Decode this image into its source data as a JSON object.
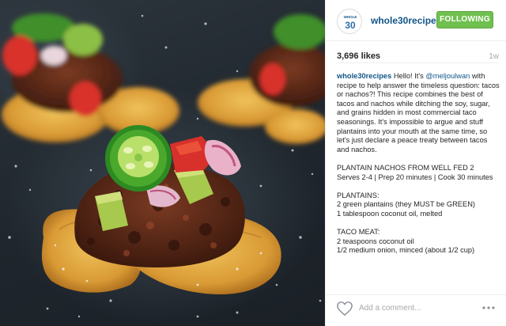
{
  "post": {
    "photo": {
      "subject": "plantain nachos with taco meat, jalapeno, avocado, tomato and onion on a dark slate board"
    },
    "header": {
      "avatar": {
        "logo_text_top": "WHOLE",
        "logo_text_number": "30"
      },
      "username": "whole30recipes",
      "follow_label": "FOLLOWING",
      "follow_color": "#70c050"
    },
    "likes": "3,696 likes",
    "time": "1w",
    "caption": {
      "username": "whole30recipes",
      "intro_1": " Hello! It's ",
      "mention": "@meljoulwan",
      "intro_2": " with recipe to help answer the timeless question: tacos or nachos?! This recipe combines the best of tacos and nachos while ditching the soy, sugar, and grains hidden in most commercial taco seasonings. It's impossible to argue and stuff plantains into your mouth at the same time, so let's just declare a peace treaty between tacos and nachos.",
      "recipe_title": "PLANTAIN NACHOS FROM WELL FED 2",
      "recipe_meta": "Serves 2-4 | Prep 20 minutes | Cook 30 minutes",
      "plantains_heading": "PLANTAINS:",
      "plantains_line_1": "2 green plantains (they MUST be GREEN)",
      "plantains_line_2": "1 tablespoon coconut oil, melted",
      "taco_heading": "TACO MEAT:",
      "taco_line_1": "2 teaspoons coconut oil",
      "taco_line_2": "1/2 medium onion, minced (about 1/2 cup)"
    },
    "comment": {
      "placeholder": "Add a comment...",
      "more_label": "..."
    },
    "colors": {
      "link": "#125688",
      "muted": "#a5a7aa"
    }
  }
}
